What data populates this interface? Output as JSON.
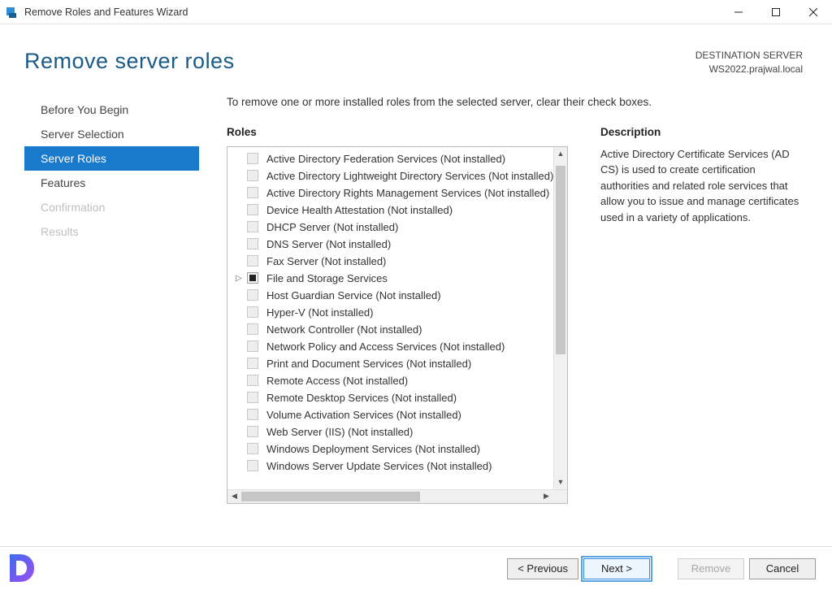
{
  "window": {
    "title": "Remove Roles and Features Wizard"
  },
  "header": {
    "title": "Remove server roles",
    "dest_label": "DESTINATION SERVER",
    "dest_server": "WS2022.prajwal.local"
  },
  "nav": {
    "items": [
      {
        "label": "Before You Begin",
        "state": "normal"
      },
      {
        "label": "Server Selection",
        "state": "normal"
      },
      {
        "label": "Server Roles",
        "state": "selected"
      },
      {
        "label": "Features",
        "state": "normal"
      },
      {
        "label": "Confirmation",
        "state": "disabled"
      },
      {
        "label": "Results",
        "state": "disabled"
      }
    ]
  },
  "content": {
    "instruction": "To remove one or more installed roles from the selected server, clear their check boxes.",
    "roles_header": "Roles",
    "desc_header": "Description",
    "description": "Active Directory Certificate Services (AD CS) is used to create certification authorities and related role services that allow you to issue and manage certificates used in a variety of applications.",
    "roles": [
      {
        "label": "Active Directory Federation Services (Not installed)",
        "check": "disabled"
      },
      {
        "label": "Active Directory Lightweight Directory Services (Not installed)",
        "check": "disabled"
      },
      {
        "label": "Active Directory Rights Management Services (Not installed)",
        "check": "disabled"
      },
      {
        "label": "Device Health Attestation (Not installed)",
        "check": "disabled"
      },
      {
        "label": "DHCP Server (Not installed)",
        "check": "disabled"
      },
      {
        "label": "DNS Server (Not installed)",
        "check": "disabled"
      },
      {
        "label": "Fax Server (Not installed)",
        "check": "disabled"
      },
      {
        "label": "File and Storage Services",
        "check": "indeterminate",
        "expandable": true
      },
      {
        "label": "Host Guardian Service (Not installed)",
        "check": "disabled"
      },
      {
        "label": "Hyper-V (Not installed)",
        "check": "disabled"
      },
      {
        "label": "Network Controller (Not installed)",
        "check": "disabled"
      },
      {
        "label": "Network Policy and Access Services (Not installed)",
        "check": "disabled"
      },
      {
        "label": "Print and Document Services (Not installed)",
        "check": "disabled"
      },
      {
        "label": "Remote Access (Not installed)",
        "check": "disabled"
      },
      {
        "label": "Remote Desktop Services (Not installed)",
        "check": "disabled"
      },
      {
        "label": "Volume Activation Services (Not installed)",
        "check": "disabled"
      },
      {
        "label": "Web Server (IIS) (Not installed)",
        "check": "disabled"
      },
      {
        "label": "Windows Deployment Services (Not installed)",
        "check": "disabled"
      },
      {
        "label": "Windows Server Update Services (Not installed)",
        "check": "disabled"
      }
    ]
  },
  "footer": {
    "previous": "< Previous",
    "next": "Next >",
    "remove": "Remove",
    "cancel": "Cancel"
  }
}
